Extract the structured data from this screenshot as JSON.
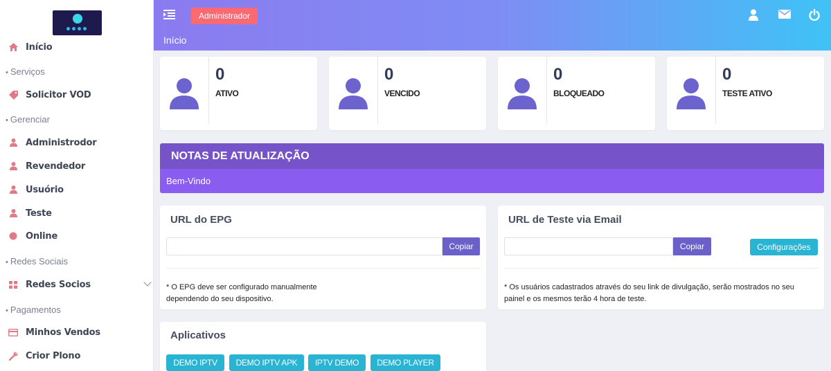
{
  "sidebar": {
    "items": [
      {
        "label": "Início",
        "icon": "home-icon"
      },
      {
        "section": "Serviços"
      },
      {
        "label": "Solicitor VOD",
        "icon": "tag-icon"
      },
      {
        "section": "Gerenciar"
      },
      {
        "label": "Administrodor",
        "icon": "user-icon"
      },
      {
        "label": "Revendedor",
        "icon": "user-icon"
      },
      {
        "label": "Usuório",
        "icon": "user-icon"
      },
      {
        "label": "Teste",
        "icon": "user-icon"
      },
      {
        "label": "Online",
        "icon": "circle-icon"
      },
      {
        "section": "Redes Sociais"
      },
      {
        "label": "Redes Socios",
        "icon": "grid-icon"
      },
      {
        "section": "Pagamentos"
      },
      {
        "label": "Minhos Vendos",
        "icon": "credit-card-icon"
      },
      {
        "label": "Crior Plono",
        "icon": "wrench-icon"
      }
    ]
  },
  "header": {
    "admin_button": "Administrador",
    "breadcrumb": "Início"
  },
  "stats": [
    {
      "value": "0",
      "label": "ATIVO"
    },
    {
      "value": "0",
      "label": "VENCIDO"
    },
    {
      "value": "0",
      "label": "BLOQUEADO"
    },
    {
      "value": "0",
      "label": "TESTE ATIVO"
    }
  ],
  "notes": {
    "title": "NOTAS DE ATUALIZAÇÃO",
    "body": "Bem-Vindo"
  },
  "epg": {
    "title": "URL do EPG",
    "input_value": "",
    "copy_label": "Copiar",
    "note_line1": "* O EPG deve ser configurado manualmente",
    "note_line2": "dependendo do seu dispositivo."
  },
  "email_test": {
    "title": "URL de Teste via Email",
    "input_value": "",
    "copy_label": "Copiar",
    "config_label": "Configurações",
    "note_line1": "* Os usuários cadastrados através do seu link de divulgação, serão mostrados no seu",
    "note_line2": "painel e os mesmos terão 4 hora de teste."
  },
  "apps": {
    "title": "Aplicativos",
    "buttons": [
      "DEMO IPTV",
      "DEMO IPTV APK",
      "IPTV DEMO",
      "DEMO PLAYER"
    ]
  },
  "colors": {
    "accent": "#6b5fca",
    "danger": "#fb6a72",
    "info": "#29b4d4",
    "notes_header": "#7653c9",
    "notes_body": "#8a5cf0"
  }
}
